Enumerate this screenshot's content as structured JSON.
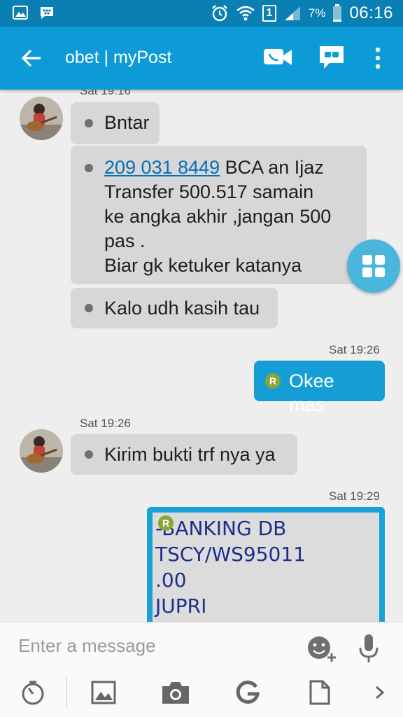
{
  "status_bar": {
    "battery_percent": "7%",
    "sim_slot": "1",
    "time": "06:16"
  },
  "app_bar": {
    "title": "obet | myPost"
  },
  "messages": {
    "m1_partial_timestamp": "Sat 19:16",
    "m1_text": "Bntar",
    "m2_link": "209 031 8449",
    "m2_line1_rest": " BCA an Ijaz",
    "m2_line2": "Transfer 500.517 samain",
    "m2_line3": "ke angka akhir ,jangan 500",
    "m2_line4": "pas .",
    "m2_line5": "Biar gk ketuker katanya",
    "m3_text": "Kalo udh kasih tau",
    "out1_timestamp": "Sat 19:26",
    "out1_text": "Okee mas",
    "out_badge": "R",
    "in2_timestamp": "Sat 19:26",
    "in2_text": "Kirim bukti trf nya ya",
    "out2_timestamp": "Sat 19:29",
    "image_line1": "-BANKING DB",
    "image_line2": "TSCY/WS95011",
    "image_line3": ".00",
    "image_line4": "JUPRI"
  },
  "composer": {
    "placeholder": "Enter a message"
  },
  "colors": {
    "status_bar": "#0a7fb4",
    "app_bar": "#0d9bd7",
    "incoming_bubble": "#d7d7d7",
    "outgoing_bubble": "#159ed6",
    "link": "#0a6fb7"
  }
}
